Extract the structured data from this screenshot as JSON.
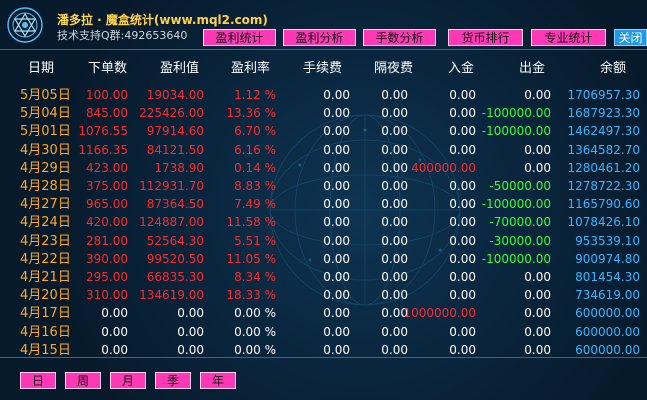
{
  "header": {
    "title": "潘多拉 · 魔盒统计(www.mql2.com)",
    "subtitle": "技术支持Q群:492653640"
  },
  "tabs": [
    "盈利统计",
    "盈利分析",
    "手数分析",
    "货币排行",
    "专业统计",
    "关闭"
  ],
  "columns": [
    "日期",
    "下单数",
    "盈利值",
    "盈利率",
    "手续费",
    "隔夜费",
    "入金",
    "出金",
    "余额"
  ],
  "rows": [
    [
      "5月05日",
      "100.00",
      "19034.00",
      "1.12 %",
      "0.00",
      "0.00",
      "0.00",
      "0.00",
      "1706957.30"
    ],
    [
      "5月04日",
      "845.00",
      "225426.00",
      "13.36 %",
      "0.00",
      "0.00",
      "0.00",
      "-100000.00",
      "1687923.30"
    ],
    [
      "5月01日",
      "1076.55",
      "97914.60",
      "6.70 %",
      "0.00",
      "0.00",
      "0.00",
      "-100000.00",
      "1462497.30"
    ],
    [
      "4月30日",
      "1166.35",
      "84121.50",
      "6.16 %",
      "0.00",
      "0.00",
      "0.00",
      "0.00",
      "1364582.70"
    ],
    [
      "4月29日",
      "423.00",
      "1738.90",
      "0.14 %",
      "0.00",
      "0.00",
      "400000.00",
      "0.00",
      "1280461.20"
    ],
    [
      "4月28日",
      "375.00",
      "112931.70",
      "8.83 %",
      "0.00",
      "0.00",
      "0.00",
      "-50000.00",
      "1278722.30"
    ],
    [
      "4月27日",
      "965.00",
      "87364.50",
      "7.49 %",
      "0.00",
      "0.00",
      "0.00",
      "-100000.00",
      "1165790.60"
    ],
    [
      "4月24日",
      "420.00",
      "124887.00",
      "11.58 %",
      "0.00",
      "0.00",
      "0.00",
      "-70000.00",
      "1078426.10"
    ],
    [
      "4月23日",
      "281.00",
      "52564.30",
      "5.51 %",
      "0.00",
      "0.00",
      "0.00",
      "-30000.00",
      "953539.10"
    ],
    [
      "4月22日",
      "390.00",
      "99520.50",
      "11.05 %",
      "0.00",
      "0.00",
      "0.00",
      "-100000.00",
      "900974.80"
    ],
    [
      "4月21日",
      "295.00",
      "66835.30",
      "8.34 %",
      "0.00",
      "0.00",
      "0.00",
      "0.00",
      "801454.30"
    ],
    [
      "4月20日",
      "310.00",
      "134619.00",
      "18.33 %",
      "0.00",
      "0.00",
      "0.00",
      "0.00",
      "734619.00"
    ],
    [
      "4月17日",
      "0.00",
      "0.00",
      "0.00 %",
      "0.00",
      "0.00",
      "1000000.00",
      "0.00",
      "600000.00"
    ],
    [
      "4月16日",
      "0.00",
      "0.00",
      "0.00 %",
      "0.00",
      "0.00",
      "0.00",
      "0.00",
      "600000.00"
    ],
    [
      "4月15日",
      "0.00",
      "0.00",
      "0.00 %",
      "0.00",
      "0.00",
      "0.00",
      "0.00",
      "600000.00"
    ]
  ],
  "period_buttons": [
    "日",
    "周",
    "月",
    "季",
    "年"
  ],
  "colors": {
    "date": "#ffa726",
    "profit": "#ff2a2a",
    "neutral": "#ffffff",
    "withdraw": "#33ff33",
    "balance": "#35b6ff",
    "tab": "#ff39b6",
    "close_tab": "#1f98e8"
  }
}
